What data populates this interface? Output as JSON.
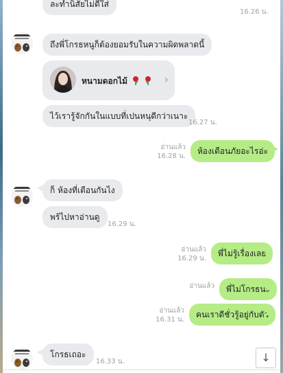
{
  "colors": {
    "incoming": "#e9eaee",
    "outgoing": "#b5ec86",
    "meta": "#9aa0a6"
  },
  "icons": {
    "scroll": "arrow-down-icon",
    "chevron": "chevron-right-icon",
    "rose": "rose-emoji-icon"
  },
  "messages": [
    {
      "dir": "in",
      "text": "ละทำนิสัยไม่ดีใส่",
      "time": "16.26 น."
    },
    {
      "dir": "in",
      "text": "ถึงพี่โกรธหนูก็ต้องยอมรับในความผิดพลาดนี้",
      "time": ""
    },
    {
      "dir": "in",
      "type": "contact",
      "contact_name": "หนามดอกไม้",
      "time": ""
    },
    {
      "dir": "in",
      "text": "ไว้เรารู้จักกันในแบบที่เปนหนุดีกว่าเนาะ",
      "time": "16.27 น."
    },
    {
      "dir": "out",
      "text": "ห้องเดือนภัยอะไรอ่ะ",
      "read": "อ่านแล้ว",
      "time": "16.28 น."
    },
    {
      "dir": "in",
      "text": "ก็ ห้องที่เตือนกันไง",
      "time": ""
    },
    {
      "dir": "in",
      "text": "พร้ไปหาอ่านดู",
      "time": "16.29 น."
    },
    {
      "dir": "out",
      "text": "พี่ไม่รู้เรื่องเลย",
      "read": "อ่านแล้ว",
      "time": "16.29 น."
    },
    {
      "dir": "out",
      "text": "พี่ไม่โกรธนะ",
      "read": "อ่านแล้ว",
      "time": ""
    },
    {
      "dir": "out",
      "text": "คนเราดีชั่วรู้อยู่กับตัว",
      "read": "อ่านแล้ว",
      "time": "16.31 น."
    },
    {
      "dir": "in",
      "text": "โกรธเถอะ",
      "time": "16.33 น."
    }
  ]
}
